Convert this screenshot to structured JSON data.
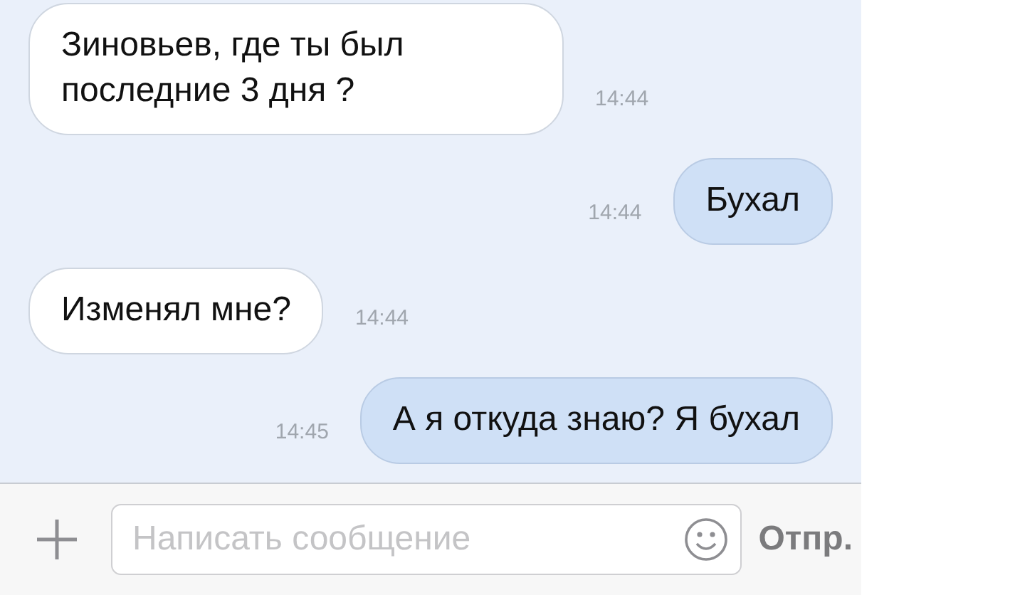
{
  "messages": [
    {
      "kind": "incoming",
      "text": "Зиновьев, где ты был последние 3 дня ?",
      "time": "14:44"
    },
    {
      "kind": "outgoing",
      "text": "Бухал",
      "time": "14:44"
    },
    {
      "kind": "incoming",
      "text": "Изменял мне?",
      "time": "14:44"
    },
    {
      "kind": "outgoing",
      "text": "А я откуда знаю? Я бухал",
      "time": "14:45"
    }
  ],
  "composer": {
    "placeholder": "Написать сообщение",
    "send_label": "Отпр."
  }
}
